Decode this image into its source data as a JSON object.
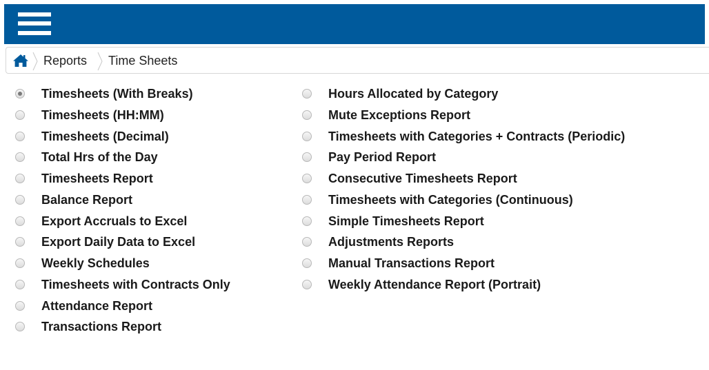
{
  "header": {
    "menu_icon": "hamburger-menu-icon",
    "brand_color": "#005a9c"
  },
  "breadcrumb": {
    "home_icon": "home-icon",
    "items": [
      "Reports",
      "Time Sheets"
    ]
  },
  "report_options": {
    "left_column": [
      {
        "label": "Timesheets (With Breaks)",
        "checked": true
      },
      {
        "label": "Timesheets (HH:MM)",
        "checked": false
      },
      {
        "label": "Timesheets (Decimal)",
        "checked": false
      },
      {
        "label": "Total Hrs of the Day",
        "checked": false
      },
      {
        "label": "Timesheets Report",
        "checked": false
      },
      {
        "label": "Balance Report",
        "checked": false
      },
      {
        "label": "Export Accruals to Excel",
        "checked": false
      },
      {
        "label": "Export Daily Data to Excel",
        "checked": false
      },
      {
        "label": "Weekly Schedules",
        "checked": false
      },
      {
        "label": "Timesheets with Contracts Only",
        "checked": false
      },
      {
        "label": "Attendance Report",
        "checked": false
      },
      {
        "label": "Transactions Report",
        "checked": false
      }
    ],
    "right_column": [
      {
        "label": "Hours Allocated by Category",
        "checked": false
      },
      {
        "label": "Mute Exceptions Report",
        "checked": false
      },
      {
        "label": "Timesheets with Categories + Contracts (Periodic)",
        "checked": false
      },
      {
        "label": "Pay Period Report",
        "checked": false
      },
      {
        "label": "Consecutive Timesheets Report",
        "checked": false
      },
      {
        "label": "Timesheets with Categories (Continuous)",
        "checked": false
      },
      {
        "label": "Simple Timesheets Report",
        "checked": false
      },
      {
        "label": "Adjustments Reports",
        "checked": false
      },
      {
        "label": "Manual Transactions Report",
        "checked": false
      },
      {
        "label": "Weekly Attendance Report (Portrait)",
        "checked": false
      }
    ]
  }
}
